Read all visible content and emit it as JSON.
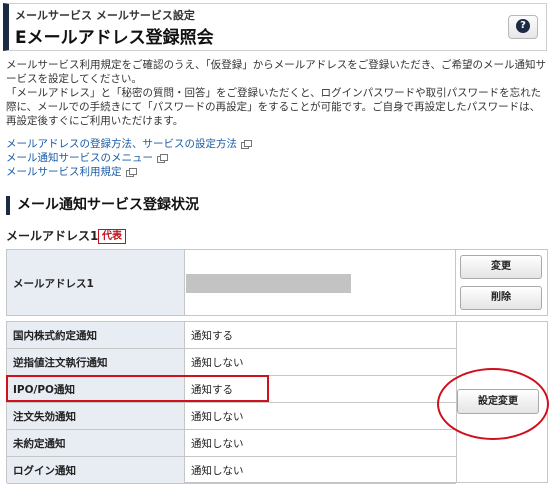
{
  "header": {
    "breadcrumb": "メールサービス メールサービス設定",
    "title": "Eメールアドレス登録照会",
    "help_icon": "question-circle-icon"
  },
  "intro": {
    "p1": "メールサービス利用規定をご確認のうえ、「仮登録」からメールアドレスをご登録いただき、ご希望のメール通知サービスを設定してください。",
    "p2": "「メールアドレス」と「秘密の質問・回答」をご登録いただくと、ログインパスワードや取引パスワードを忘れた際に、メールでの手続きにて「パスワードの再設定」をすることが可能です。ご自身で再設定したパスワードは、再設定後すぐにご利用いただけます。"
  },
  "links": [
    {
      "label": "メールアドレスの登録方法、サービスの設定方法"
    },
    {
      "label": "メール通知サービスのメニュー"
    },
    {
      "label": "メールサービス利用規定"
    }
  ],
  "section": {
    "title": "メール通知サービス登録状況",
    "address_heading": "メールアドレス1",
    "badge": "代表"
  },
  "address_table": {
    "label": "メールアドレス1",
    "value": "",
    "edit_label": "変更",
    "delete_label": "削除"
  },
  "notifications": {
    "rows": [
      {
        "name": "国内株式約定通知",
        "value": "通知する"
      },
      {
        "name": "逆指値注文執行通知",
        "value": "通知しない"
      },
      {
        "name": "IPO/PO通知",
        "value": "通知する"
      },
      {
        "name": "注文失効通知",
        "value": "通知しない"
      },
      {
        "name": "未約定通知",
        "value": "通知しない"
      },
      {
        "name": "ログイン通知",
        "value": "通知しない"
      }
    ],
    "change_label": "設定変更"
  },
  "colors": {
    "navy": "#1d2a44",
    "link": "#1a5ca8",
    "highlight": "#d0101d",
    "label_bg": "#e8ecf3"
  }
}
